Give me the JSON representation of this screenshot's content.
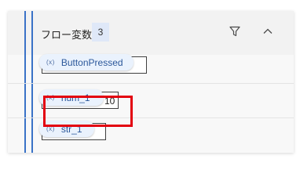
{
  "flow_variables_panel": {
    "title": "フロー変数",
    "count": "3",
    "filter_icon": "filter-icon",
    "collapse_icon": "chevron-up-icon",
    "accent_color": "#3a72c7",
    "badge_color": "#dfe8f8",
    "highlight_color": "#e3000f",
    "variables": [
      {
        "icon_glyph": "(x)",
        "name": "ButtonPressed",
        "value": ""
      },
      {
        "icon_glyph": "(x)",
        "name": "num_1",
        "value": "10"
      },
      {
        "icon_glyph": "(x)",
        "name": "str_1",
        "value": ""
      }
    ],
    "highlighted_variable": "num_1"
  }
}
